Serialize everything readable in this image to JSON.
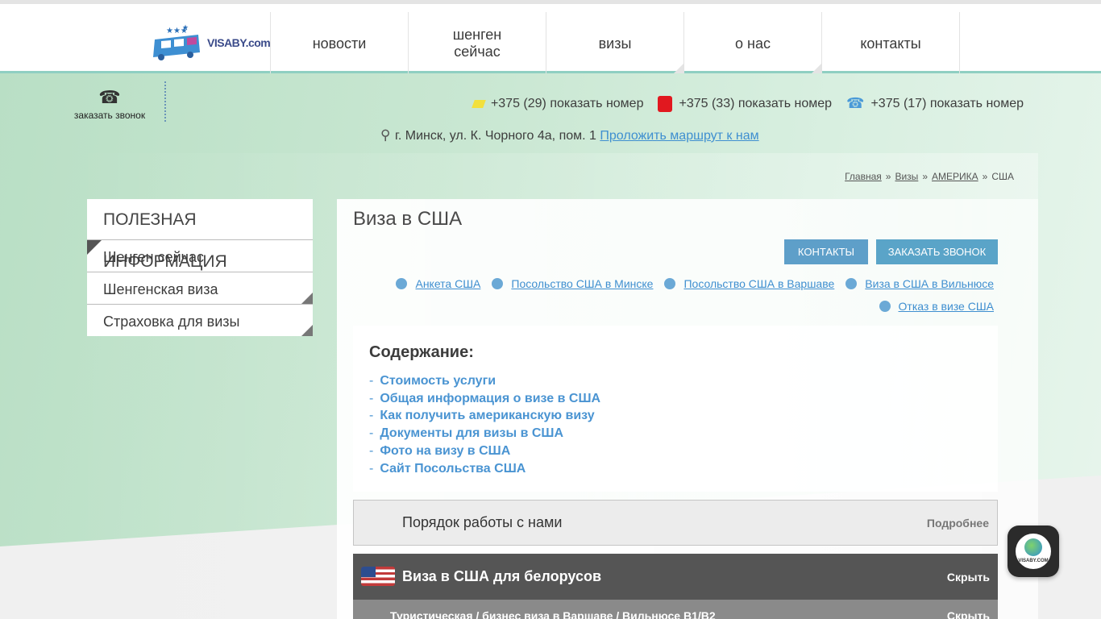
{
  "header": {
    "logo_text": "VISABY.com",
    "nav": [
      {
        "label": "новости"
      },
      {
        "label": "шенген\nсейчас"
      },
      {
        "label": "визы"
      },
      {
        "label": "о нас"
      },
      {
        "label": "контакты"
      }
    ]
  },
  "callback": {
    "label": "заказать звонок"
  },
  "phones": [
    {
      "operator": "velcom",
      "text": "+375 (29) показать номер"
    },
    {
      "operator": "mts",
      "text": "+375 (33) показать номер"
    },
    {
      "operator": "beltelecom",
      "text": "+375 (17) показать номер"
    }
  ],
  "address": {
    "text": "г. Минск, ул. К. Чорного 4а, пом. 1",
    "route_link": "Проложить маршрут к нам"
  },
  "breadcrumb": [
    "Главная",
    "Визы",
    "АМЕРИКА",
    "США"
  ],
  "breadcrumb_sep": "»",
  "sidebar": {
    "title": "ПОЛЕЗНАЯ ИНФОРМАЦИЯ",
    "items": [
      "Шенген сейчас",
      "Шенгенская виза",
      "Страховка для визы"
    ]
  },
  "main": {
    "title": "Виза в США",
    "buttons": {
      "contacts": "КОНТАКТЫ",
      "callback": "ЗАКАЗАТЬ ЗВОНОК"
    },
    "links": [
      "Анкета США",
      "Посольство США в Минске",
      "Посольство США в Варшаве",
      "Виза в США в Вильнюсе",
      "Отказ в визе США"
    ],
    "toc": {
      "heading": "Содержание:",
      "items": [
        "Стоимость услуги",
        "Общая информация о визе в США",
        "Как получить американскую визу",
        "Документы для визы в США",
        "Фото на визу в США",
        "Сайт Посольства США"
      ]
    },
    "accordions": [
      {
        "title": "Порядок работы с нами",
        "action": "Подробнее"
      },
      {
        "title": "Виза в США для белорусов",
        "action": "Скрыть"
      },
      {
        "title": "Туристическая / бизнес виза в Варшаве / Вильнюсе B1/B2",
        "action": "Скрыть"
      }
    ]
  },
  "widget": {
    "label": "VISABY.COM"
  }
}
